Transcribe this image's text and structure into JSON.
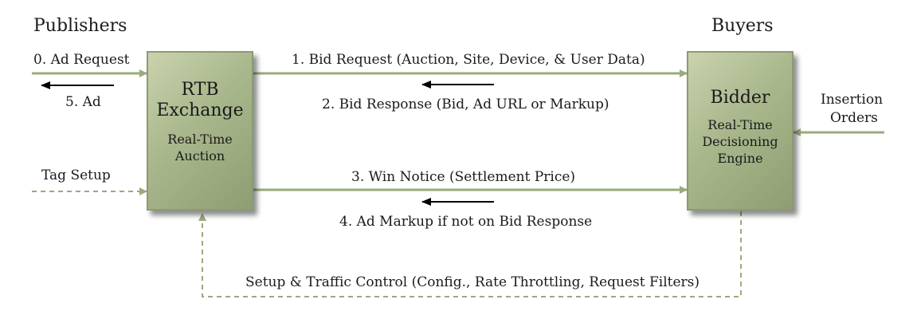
{
  "publishers_heading": "Publishers",
  "buyers_heading": "Buyers",
  "exchange": {
    "title_line1": "RTB",
    "title_line2": "Exchange",
    "subtitle_line1": "Real-Time",
    "subtitle_line2": "Auction"
  },
  "bidder": {
    "title": "Bidder",
    "subtitle_line1": "Real-Time",
    "subtitle_line2": "Decisioning",
    "subtitle_line3": "Engine"
  },
  "labels": {
    "ad_request": "0.  Ad Request",
    "ad": "5.  Ad",
    "tag_setup": "Tag Setup",
    "bid_request": "1.  Bid Request  (Auction, Site, Device, & User Data)",
    "bid_response": "2.  Bid Response  (Bid, Ad URL or Markup)",
    "win_notice": "3.  Win Notice  (Settlement Price)",
    "ad_markup": "4.  Ad Markup if not on Bid Response",
    "insertion_line1": "Insertion",
    "insertion_line2": "Orders",
    "setup_traffic": "Setup & Traffic Control  (Config., Rate Throttling, Request Filters)"
  },
  "colors": {
    "green_arrow": "#9aab7c",
    "black_arrow": "#000000",
    "box_fill": "#a9b78c"
  }
}
